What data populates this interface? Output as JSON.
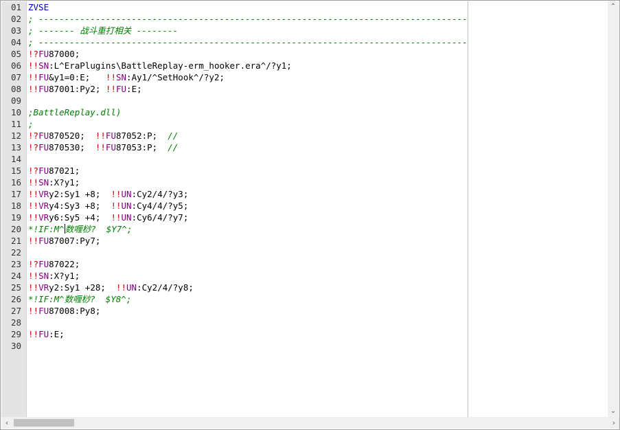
{
  "colors": {
    "keyword_blue": "#0000cc",
    "bang_red": "#cc0000",
    "receiver_purple": "#800080",
    "comment_green": "#008000",
    "default_black": "#000000",
    "gutter_bg": "#e4e4e4"
  },
  "scrollbars": {
    "up_icon": "up-arrow-icon",
    "down_icon": "down-arrow-icon",
    "left_icon": "left-arrow-icon",
    "right_icon": "right-arrow-icon"
  },
  "editor": {
    "line_numbers": [
      "01",
      "02",
      "03",
      "04",
      "05",
      "06",
      "07",
      "08",
      "09",
      "10",
      "11",
      "12",
      "13",
      "14",
      "15",
      "16",
      "17",
      "18",
      "19",
      "20",
      "21",
      "22",
      "23",
      "24",
      "25",
      "26",
      "27",
      "28",
      "29",
      "30"
    ],
    "lines": [
      [
        {
          "t": "ZVSE",
          "c": "k"
        }
      ],
      [
        {
          "t": "; -------------------------------------------------------------------------------------------",
          "c": "c"
        }
      ],
      [
        {
          "t": "; ------- 战斗重打相关 --------",
          "c": "c"
        }
      ],
      [
        {
          "t": "; -------------------------------------------------------------------------------------------",
          "c": "c"
        }
      ],
      [
        {
          "t": "!?",
          "c": "b"
        },
        {
          "t": "FU",
          "c": "r"
        },
        {
          "t": "87000;",
          "c": "d"
        }
      ],
      [
        {
          "t": "!!",
          "c": "b"
        },
        {
          "t": "SN",
          "c": "r"
        },
        {
          "t": ":L^EraPlugins\\BattleReplay-erm_hooker.era^/?y1;",
          "c": "d"
        }
      ],
      [
        {
          "t": "!!",
          "c": "b"
        },
        {
          "t": "FU",
          "c": "r"
        },
        {
          "t": "&y1=0:E;   ",
          "c": "d"
        },
        {
          "t": "!!",
          "c": "b"
        },
        {
          "t": "SN",
          "c": "r"
        },
        {
          "t": ":Ay1/^SetHook^/?y2;",
          "c": "d"
        }
      ],
      [
        {
          "t": "!!",
          "c": "b"
        },
        {
          "t": "FU",
          "c": "r"
        },
        {
          "t": "87001:Py2; ",
          "c": "d"
        },
        {
          "t": "!!",
          "c": "b"
        },
        {
          "t": "FU",
          "c": "r"
        },
        {
          "t": ":E;",
          "c": "d"
        }
      ],
      [],
      [
        {
          "t": ";BattleReplay.dll)",
          "c": "c"
        }
      ],
      [
        {
          "t": ";",
          "c": "c"
        }
      ],
      [
        {
          "t": "!?",
          "c": "b"
        },
        {
          "t": "FU",
          "c": "r"
        },
        {
          "t": "870520;  ",
          "c": "d"
        },
        {
          "t": "!!",
          "c": "b"
        },
        {
          "t": "FU",
          "c": "r"
        },
        {
          "t": "87052:P;  ",
          "c": "d"
        },
        {
          "t": "//",
          "c": "c"
        }
      ],
      [
        {
          "t": "!?",
          "c": "b"
        },
        {
          "t": "FU",
          "c": "r"
        },
        {
          "t": "870530;  ",
          "c": "d"
        },
        {
          "t": "!!",
          "c": "b"
        },
        {
          "t": "FU",
          "c": "r"
        },
        {
          "t": "87053:P;  ",
          "c": "d"
        },
        {
          "t": "//",
          "c": "c"
        }
      ],
      [],
      [
        {
          "t": "!?",
          "c": "b"
        },
        {
          "t": "FU",
          "c": "r"
        },
        {
          "t": "87021;",
          "c": "d"
        }
      ],
      [
        {
          "t": "!!",
          "c": "b"
        },
        {
          "t": "SN",
          "c": "r"
        },
        {
          "t": ":X?y1;",
          "c": "d"
        }
      ],
      [
        {
          "t": "!!",
          "c": "b"
        },
        {
          "t": "VR",
          "c": "r"
        },
        {
          "t": "y2:Sy1 +8;  ",
          "c": "d"
        },
        {
          "t": "!!",
          "c": "b"
        },
        {
          "t": "UN",
          "c": "r"
        },
        {
          "t": ":Cy2/4/?y3;",
          "c": "d"
        }
      ],
      [
        {
          "t": "!!",
          "c": "b"
        },
        {
          "t": "VR",
          "c": "r"
        },
        {
          "t": "y4:Sy3 +8;  ",
          "c": "d"
        },
        {
          "t": "!!",
          "c": "b"
        },
        {
          "t": "UN",
          "c": "r"
        },
        {
          "t": ":Cy4/4/?y5;",
          "c": "d"
        }
      ],
      [
        {
          "t": "!!",
          "c": "b"
        },
        {
          "t": "VR",
          "c": "r"
        },
        {
          "t": "y6:Sy5 +4;  ",
          "c": "d"
        },
        {
          "t": "!!",
          "c": "b"
        },
        {
          "t": "UN",
          "c": "r"
        },
        {
          "t": ":Cy6/4/?y7;",
          "c": "d"
        }
      ],
      [
        {
          "t": "*!IF:M^",
          "c": "c"
        },
        {
          "t": "",
          "c": "caret"
        },
        {
          "t": "数喱桫?  $Y7^;",
          "c": "c"
        }
      ],
      [
        {
          "t": "!!",
          "c": "b"
        },
        {
          "t": "FU",
          "c": "r"
        },
        {
          "t": "87007:Py7;",
          "c": "d"
        }
      ],
      [],
      [
        {
          "t": "!?",
          "c": "b"
        },
        {
          "t": "FU",
          "c": "r"
        },
        {
          "t": "87022;",
          "c": "d"
        }
      ],
      [
        {
          "t": "!!",
          "c": "b"
        },
        {
          "t": "SN",
          "c": "r"
        },
        {
          "t": ":X?y1;",
          "c": "d"
        }
      ],
      [
        {
          "t": "!!",
          "c": "b"
        },
        {
          "t": "VR",
          "c": "r"
        },
        {
          "t": "y2:Sy1 +28;  ",
          "c": "d"
        },
        {
          "t": "!!",
          "c": "b"
        },
        {
          "t": "UN",
          "c": "r"
        },
        {
          "t": ":Cy2/4/?y8;",
          "c": "d"
        }
      ],
      [
        {
          "t": "*!IF:M^数喱桫?  $Y8^;",
          "c": "c"
        }
      ],
      [
        {
          "t": "!!",
          "c": "b"
        },
        {
          "t": "FU",
          "c": "r"
        },
        {
          "t": "87008:Py8;",
          "c": "d"
        }
      ],
      [],
      [
        {
          "t": "!!",
          "c": "b"
        },
        {
          "t": "FU",
          "c": "r"
        },
        {
          "t": ":E;",
          "c": "d"
        }
      ],
      []
    ]
  }
}
